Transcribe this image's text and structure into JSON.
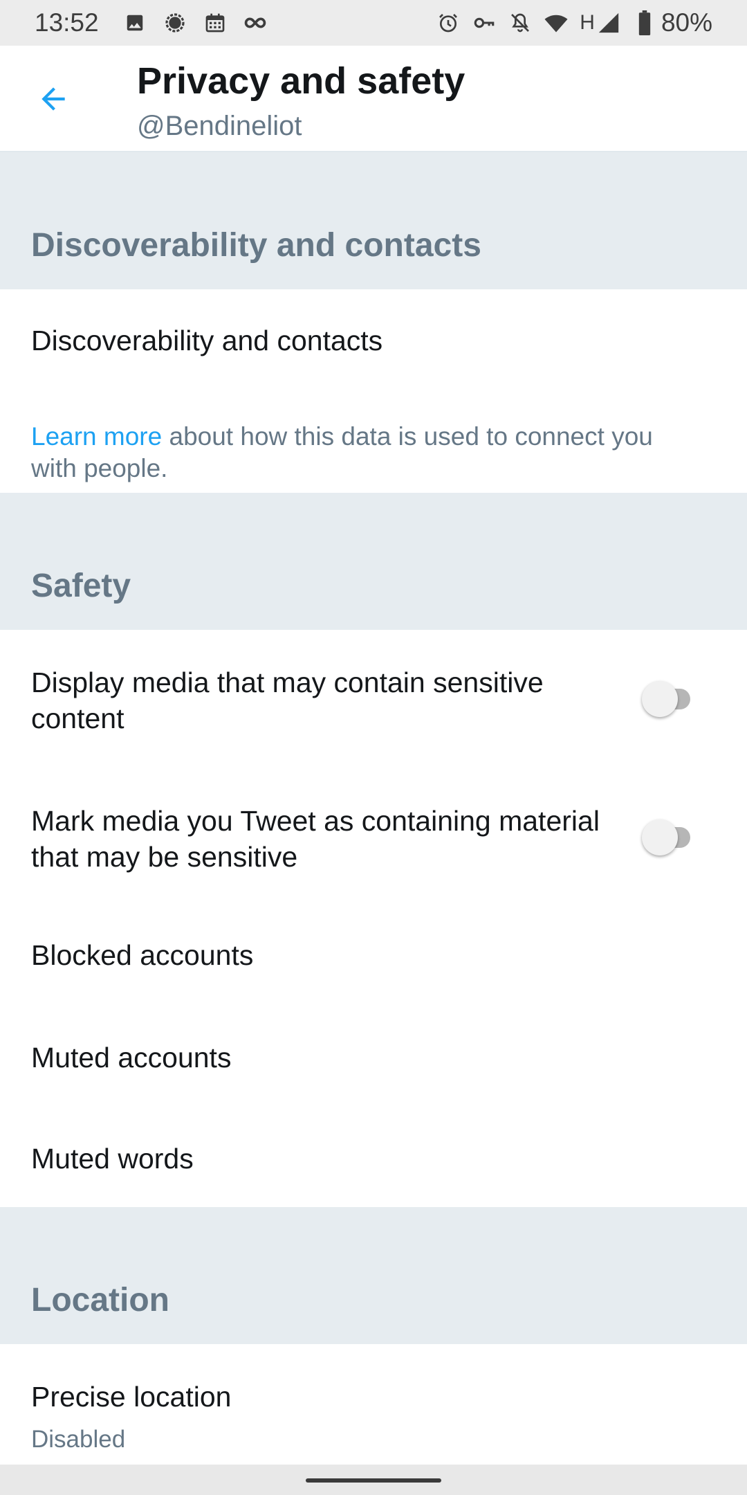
{
  "status_bar": {
    "time": "13:52",
    "network_type": "H",
    "battery": "80%",
    "left_icons": [
      "image-icon",
      "signal-app-icon",
      "calendar-icon",
      "infinity-icon"
    ],
    "right_icons": [
      "alarm-icon",
      "vpn-key-icon",
      "notifications-off-icon",
      "wifi-icon",
      "cell-signal-icon",
      "battery-icon"
    ]
  },
  "app_bar": {
    "title": "Privacy and safety",
    "subtitle": "@Bendineliot",
    "back_icon": "arrow-back-icon"
  },
  "sections": {
    "discoverability": {
      "header": "Discoverability and contacts",
      "item": "Discoverability and contacts",
      "learn_more_link": "Learn more",
      "learn_more_text": " about how this data is used to connect you with people."
    },
    "safety": {
      "header": "Safety",
      "sensitive_media": {
        "label": "Display media that may contain sensitive content",
        "enabled": false
      },
      "mark_media": {
        "label": "Mark media you Tweet as containing material that may be sensitive",
        "enabled": false
      },
      "blocked": "Blocked accounts",
      "muted_accounts": "Muted accounts",
      "muted_words": "Muted words"
    },
    "location": {
      "header": "Location",
      "precise_location": "Precise location",
      "precise_location_value": "Disabled"
    }
  },
  "colors": {
    "accent": "#1da1f2",
    "section_bg": "#e6ecf0",
    "secondary_text": "#657786",
    "primary_text": "#14171a"
  }
}
